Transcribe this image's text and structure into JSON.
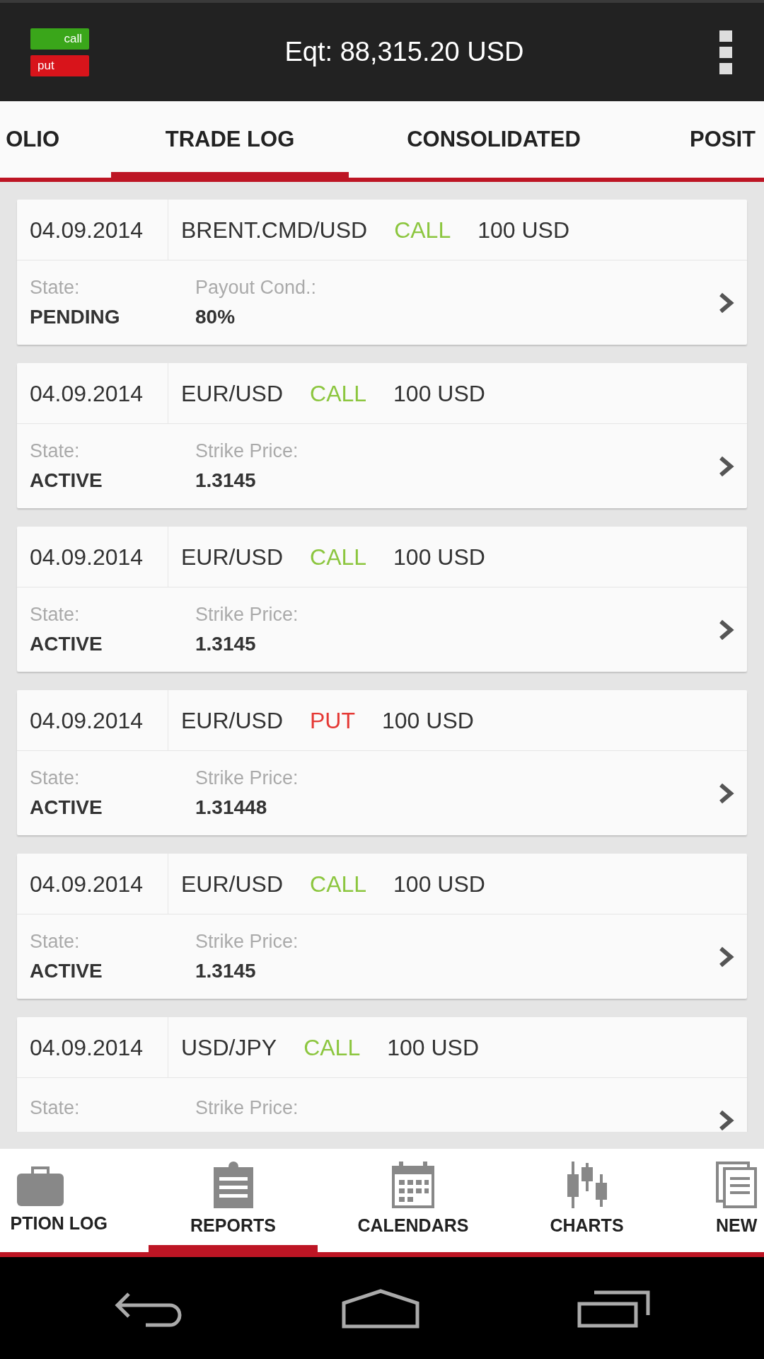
{
  "app_bar": {
    "logo": {
      "call_label": "call",
      "put_label": "put"
    },
    "equity": "Eqt: 88,315.20 USD"
  },
  "tabs": [
    {
      "label": "OLIO",
      "selected": false
    },
    {
      "label": "TRADE LOG",
      "selected": true
    },
    {
      "label": "CONSOLIDATED",
      "selected": false
    },
    {
      "label": "POSIT",
      "selected": false
    }
  ],
  "trades": [
    {
      "date": "04.09.2014",
      "instrument": "BRENT.CMD/USD",
      "direction": "CALL",
      "kind": "call",
      "amount": "100 USD",
      "state_label": "State:",
      "state": "PENDING",
      "detail_label": "Payout Cond.:",
      "detail_value": "80%"
    },
    {
      "date": "04.09.2014",
      "instrument": "EUR/USD",
      "direction": "CALL",
      "kind": "call",
      "amount": "100 USD",
      "state_label": "State:",
      "state": "ACTIVE",
      "detail_label": "Strike Price:",
      "detail_value": "1.3145"
    },
    {
      "date": "04.09.2014",
      "instrument": "EUR/USD",
      "direction": "CALL",
      "kind": "call",
      "amount": "100 USD",
      "state_label": "State:",
      "state": "ACTIVE",
      "detail_label": "Strike Price:",
      "detail_value": "1.3145"
    },
    {
      "date": "04.09.2014",
      "instrument": "EUR/USD",
      "direction": "PUT",
      "kind": "put",
      "amount": "100 USD",
      "state_label": "State:",
      "state": "ACTIVE",
      "detail_label": "Strike Price:",
      "detail_value": "1.31448"
    },
    {
      "date": "04.09.2014",
      "instrument": "EUR/USD",
      "direction": "CALL",
      "kind": "call",
      "amount": "100 USD",
      "state_label": "State:",
      "state": "ACTIVE",
      "detail_label": "Strike Price:",
      "detail_value": "1.3145"
    },
    {
      "date": "04.09.2014",
      "instrument": "USD/JPY",
      "direction": "CALL",
      "kind": "call",
      "amount": "100 USD",
      "state_label": "State:",
      "detail_label": "Strike Price:"
    }
  ],
  "bottom_nav": [
    {
      "label": "PTION LOG",
      "kind": "briefcase",
      "selected": false
    },
    {
      "label": "REPORTS",
      "kind": "clipboard",
      "selected": true
    },
    {
      "label": "CALENDARS",
      "kind": "calendar",
      "selected": false
    },
    {
      "label": "CHARTS",
      "kind": "candles",
      "selected": false
    },
    {
      "label": "NEW",
      "kind": "document",
      "selected": false
    }
  ]
}
